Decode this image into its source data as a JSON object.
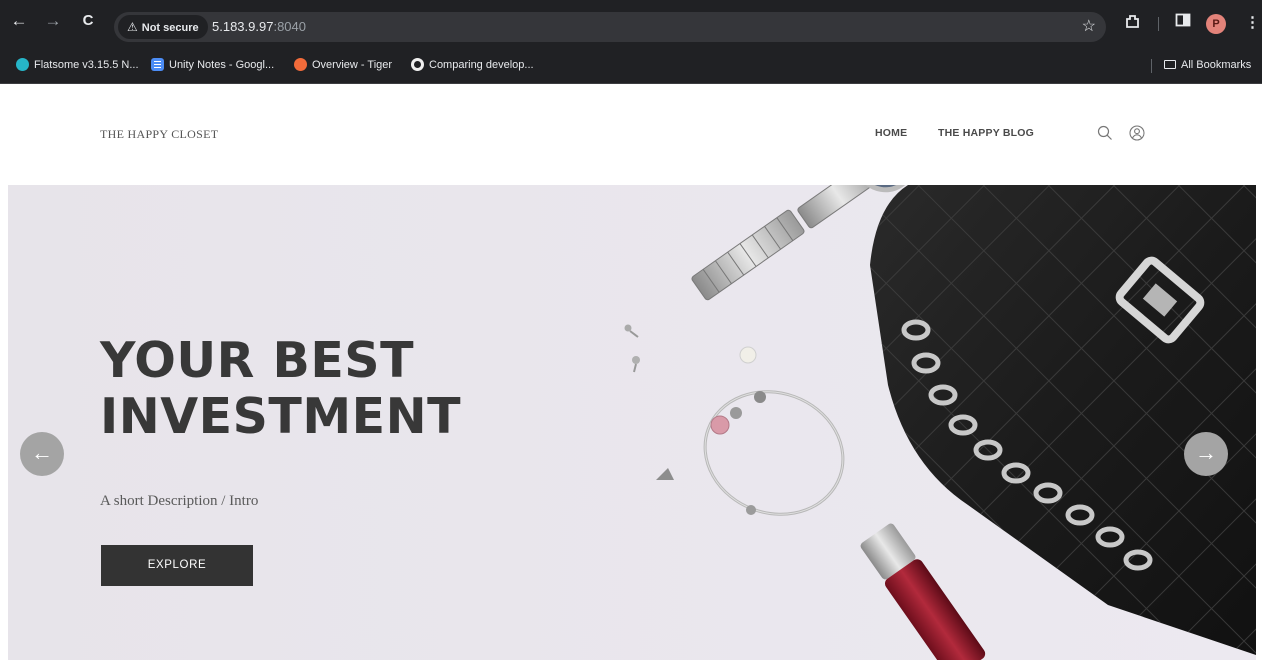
{
  "browser": {
    "nav": {
      "back": "←",
      "forward": "→",
      "reload": "C"
    },
    "omnibox": {
      "security_label": "Not secure",
      "host": "5.183.9.97",
      "port": ":8040"
    },
    "profile_initial": "P",
    "bookmarks": [
      {
        "label": "Flatsome v3.15.5 N...",
        "icon": "flatsome-icon"
      },
      {
        "label": "Unity Notes - Googl...",
        "icon": "google-docs-icon"
      },
      {
        "label": "Overview - Tiger",
        "icon": "tiger-icon"
      },
      {
        "label": "Comparing develop...",
        "icon": "github-icon"
      }
    ],
    "all_bookmarks_label": "All Bookmarks"
  },
  "site": {
    "logo": "THE HAPPY CLOSET",
    "nav": [
      {
        "label": "HOME"
      },
      {
        "label": "THE HAPPY BLOG"
      }
    ]
  },
  "hero": {
    "title_lines": [
      "YOUR BEST",
      "INVESTMENT"
    ],
    "subtitle": "A short Description / Intro",
    "button_label": "EXPLORE",
    "prev_arrow": "←",
    "next_arrow": "→"
  },
  "colors": {
    "chrome_bg": "#202124",
    "omnibox_bg": "#35363a",
    "hero_bg": "#ebe8ef",
    "title_text": "#383838",
    "button_bg": "#333333"
  }
}
